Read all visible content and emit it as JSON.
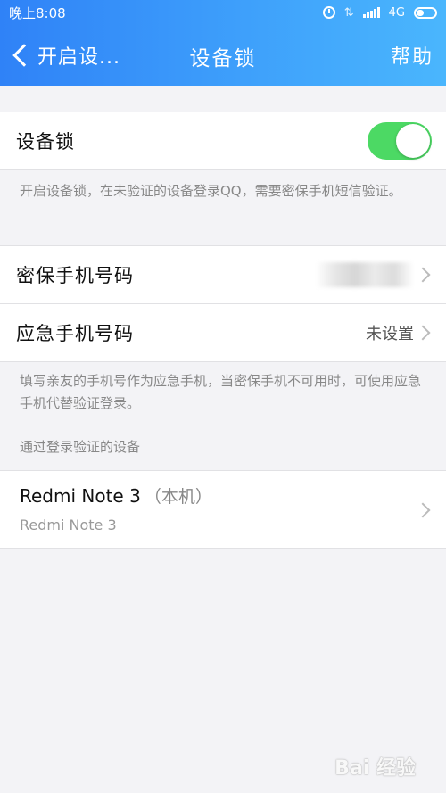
{
  "statusbar": {
    "time": "晚上8:08",
    "network": "4G"
  },
  "navbar": {
    "back_label": "开启设...",
    "title": "设备锁",
    "help": "帮助"
  },
  "device_lock": {
    "label": "设备锁",
    "enabled": true,
    "note": "开启设备锁，在未验证的设备登录QQ，需要密保手机短信验证。"
  },
  "phones": {
    "security_label": "密保手机号码",
    "emergency_label": "应急手机号码",
    "emergency_value": "未设置",
    "note": "填写亲友的手机号作为应急手机，当密保手机不可用时，可使用应急手机代替验证登录。"
  },
  "devices": {
    "section_title": "通过登录验证的设备",
    "items": [
      {
        "name": "Redmi Note 3",
        "suffix": "（本机）",
        "model": "Redmi Note 3"
      }
    ]
  },
  "colors": {
    "header_start": "#2f82f7",
    "header_end": "#4ab6fd",
    "toggle_on": "#4cd964"
  },
  "watermark": "Bai 经验"
}
